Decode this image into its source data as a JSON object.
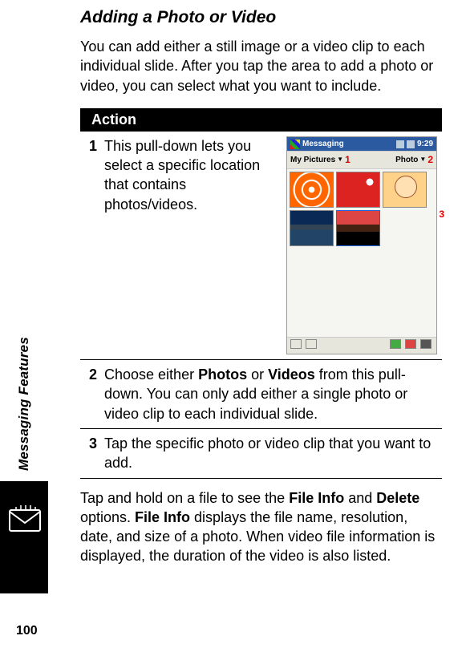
{
  "sidebar": {
    "section_label": "Messaging Features"
  },
  "page_number": "100",
  "heading": "Adding a Photo or Video",
  "intro": "You can add either a still image or a video clip to each individual slide. After you tap the area to add a photo or video, you can select what you want to include.",
  "table": {
    "header": "Action",
    "steps": [
      {
        "num": "1",
        "text": "This pull-down lets you select a specific location that contains photos/videos."
      },
      {
        "num": "2",
        "text_before": "Choose either ",
        "b1": "Photos",
        "mid1": " or ",
        "b2": "Videos",
        "text_after": " from this pull-down. You can only add either a single photo or video clip to each individual slide."
      },
      {
        "num": "3",
        "text": "Tap the specific photo or video clip that you want to add."
      }
    ]
  },
  "mockup": {
    "title": "Messaging",
    "time": "9:29",
    "left_label": "My Pictures",
    "right_label": "Photo",
    "callouts": {
      "c1": "1",
      "c2": "2",
      "c3": "3"
    }
  },
  "para": {
    "t1": "Tap and hold on a file to see the ",
    "b1": "File Info",
    "t2": " and ",
    "b2": "Delete",
    "t3": " options. ",
    "b3": "File Info",
    "t4": " displays the file name, resolution, date, and size of a photo. When video file information is displayed, the duration of the video is also listed."
  }
}
